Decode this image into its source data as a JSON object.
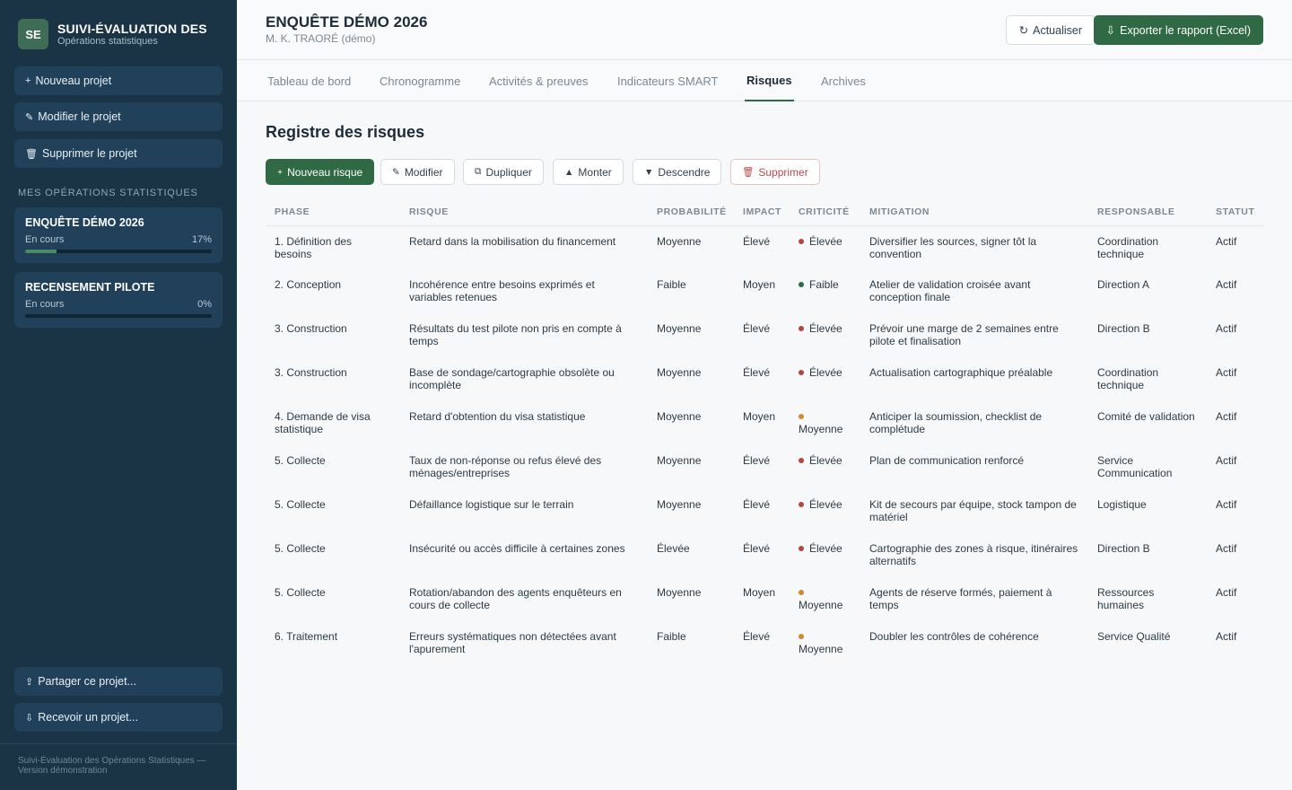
{
  "sidebar": {
    "logo": "SE",
    "title": "SUIVI-ÉVALUATION DES",
    "subtitle": "Opérations statistiques",
    "actions": [
      {
        "icon": "+",
        "label": "Nouveau projet"
      },
      {
        "icon": "✎",
        "label": "Modifier le projet"
      },
      {
        "icon": "🗑",
        "label": "Supprimer le projet"
      }
    ],
    "section_label": "MES OPÉRATIONS STATISTIQUES",
    "projects": [
      {
        "title": "ENQUÊTE DÉMO 2026",
        "status": "En cours",
        "progress_label": "17%",
        "progress": 17
      },
      {
        "title": "RECENSEMENT PILOTE",
        "status": "En cours",
        "progress_label": "0%",
        "progress": 0
      }
    ],
    "share": {
      "icon": "⇪",
      "label": "Partager ce projet..."
    },
    "receive": {
      "icon": "⇩",
      "label": "Recevoir un projet..."
    },
    "footer": "Suivi-Évaluation des Opérations Statistiques — Version démonstration"
  },
  "header": {
    "title": "ENQUÊTE DÉMO 2026",
    "subtitle": "M. K. TRAORÉ (démo)",
    "refresh_icon": "↻",
    "refresh_label": "Actualiser",
    "export_icon": "⇩",
    "export_label": "Exporter le rapport (Excel)"
  },
  "tabs": [
    {
      "label": "Tableau de bord"
    },
    {
      "label": "Chronogramme"
    },
    {
      "label": "Activités & preuves"
    },
    {
      "label": "Indicateurs SMART"
    },
    {
      "label": "Risques",
      "active": true
    },
    {
      "label": "Archives"
    }
  ],
  "risks": {
    "title": "Registre des risques",
    "actions": {
      "new": {
        "icon": "+",
        "label": "Nouveau risque"
      },
      "edit": {
        "icon": "✎",
        "label": "Modifier"
      },
      "duplicate": {
        "icon": "⧉",
        "label": "Dupliquer"
      },
      "up": {
        "icon": "▲",
        "label": "Monter"
      },
      "down": {
        "icon": "▼",
        "label": "Descendre"
      },
      "delete": {
        "icon": "🗑",
        "label": "Supprimer"
      }
    },
    "columns": [
      "PHASE",
      "RISQUE",
      "PROBABILITÉ",
      "IMPACT",
      "CRITICITÉ",
      "MITIGATION",
      "RESPONSABLE",
      "STATUT"
    ],
    "criticity_colors": {
      "Élevée": "#b8453d",
      "Faible": "#2f6a44",
      "Moyenne": "#d38a2a"
    },
    "rows": [
      {
        "phase": "1. Définition des besoins",
        "risk": "Retard dans la mobilisation du financement",
        "probability": "Moyenne",
        "impact": "Élevé",
        "criticity": "Élevée",
        "mitigation": "Diversifier les sources, signer tôt la convention",
        "owner": "Coordination technique",
        "status": "Actif"
      },
      {
        "phase": "2. Conception",
        "risk": "Incohérence entre besoins exprimés et variables retenues",
        "probability": "Faible",
        "impact": "Moyen",
        "criticity": "Faible",
        "mitigation": "Atelier de validation croisée avant conception finale",
        "owner": "Direction A",
        "status": "Actif"
      },
      {
        "phase": "3. Construction",
        "risk": "Résultats du test pilote non pris en compte à temps",
        "probability": "Moyenne",
        "impact": "Élevé",
        "criticity": "Élevée",
        "mitigation": "Prévoir une marge de 2 semaines entre pilote et finalisation",
        "owner": "Direction B",
        "status": "Actif"
      },
      {
        "phase": "3. Construction",
        "risk": "Base de sondage/cartographie obsolète ou incomplète",
        "probability": "Moyenne",
        "impact": "Élevé",
        "criticity": "Élevée",
        "mitigation": "Actualisation cartographique préalable",
        "owner": "Coordination technique",
        "status": "Actif"
      },
      {
        "phase": "4. Demande de visa statistique",
        "risk": "Retard d'obtention du visa statistique",
        "probability": "Moyenne",
        "impact": "Moyen",
        "criticity": "Moyenne",
        "mitigation": "Anticiper la soumission, checklist de complétude",
        "owner": "Comité de validation",
        "status": "Actif"
      },
      {
        "phase": "5. Collecte",
        "risk": "Taux de non-réponse ou refus élevé des ménages/entreprises",
        "probability": "Moyenne",
        "impact": "Élevé",
        "criticity": "Élevée",
        "mitigation": "Plan de communication renforcé",
        "owner": "Service Communication",
        "status": "Actif"
      },
      {
        "phase": "5. Collecte",
        "risk": "Défaillance logistique sur le terrain",
        "probability": "Moyenne",
        "impact": "Élevé",
        "criticity": "Élevée",
        "mitigation": "Kit de secours par équipe, stock tampon de matériel",
        "owner": "Logistique",
        "status": "Actif"
      },
      {
        "phase": "5. Collecte",
        "risk": "Insécurité ou accès difficile à certaines zones",
        "probability": "Élevée",
        "impact": "Élevé",
        "criticity": "Élevée",
        "mitigation": "Cartographie des zones à risque, itinéraires alternatifs",
        "owner": "Direction B",
        "status": "Actif"
      },
      {
        "phase": "5. Collecte",
        "risk": "Rotation/abandon des agents enquêteurs en cours de collecte",
        "probability": "Moyenne",
        "impact": "Moyen",
        "criticity": "Moyenne",
        "mitigation": "Agents de réserve formés, paiement à temps",
        "owner": "Ressources humaines",
        "status": "Actif"
      },
      {
        "phase": "6. Traitement",
        "risk": "Erreurs systématiques non détectées avant l'apurement",
        "probability": "Faible",
        "impact": "Élevé",
        "criticity": "Moyenne",
        "mitigation": "Doubler les contrôles de cohérence",
        "owner": "Service Qualité",
        "status": "Actif"
      }
    ]
  }
}
